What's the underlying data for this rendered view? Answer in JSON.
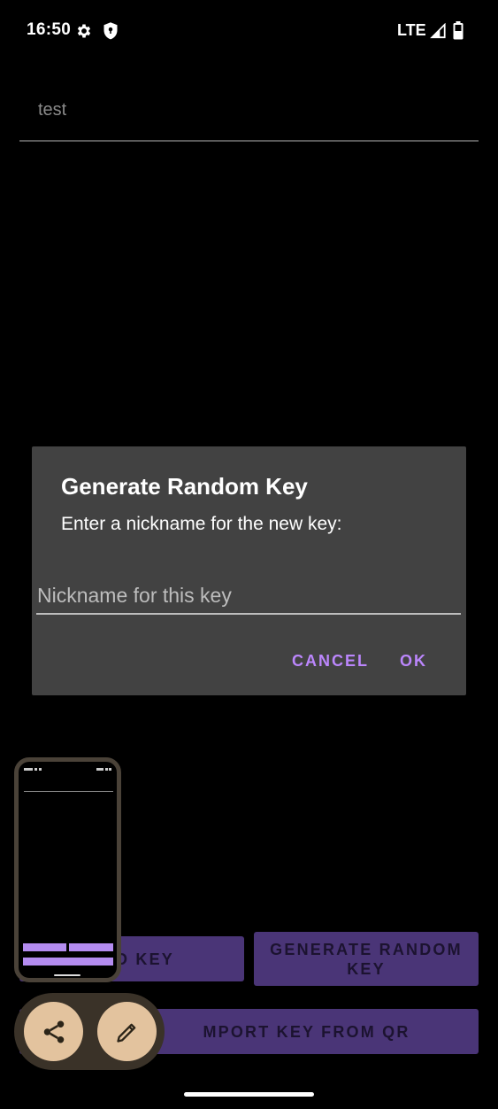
{
  "status_bar": {
    "time": "16:50",
    "network": "LTE",
    "icons": [
      "gear-icon",
      "shield-icon",
      "signal-icon",
      "battery-icon"
    ]
  },
  "top_field": {
    "value": "test"
  },
  "buttons": {
    "add_key": "ADD KEY",
    "add_key_visible": "D KEY",
    "generate_random_key": "GENERATE RANDOM KEY",
    "import_key_from_qr": "IMPORT KEY FROM QR",
    "import_key_from_qr_visible": "MPORT KEY FROM QR"
  },
  "dialog": {
    "title": "Generate Random Key",
    "message": "Enter a nickname for the new key:",
    "input_placeholder": "Nickname for this key",
    "cancel_label": "CANCEL",
    "ok_label": "OK"
  },
  "floating_actions": {
    "share_icon": "share-icon",
    "edit_icon": "pencil-icon"
  },
  "colors": {
    "button_bg": "#4a3577",
    "dialog_bg": "#424242",
    "accent": "#bb86fc",
    "fab_bg": "#e3c39e"
  }
}
